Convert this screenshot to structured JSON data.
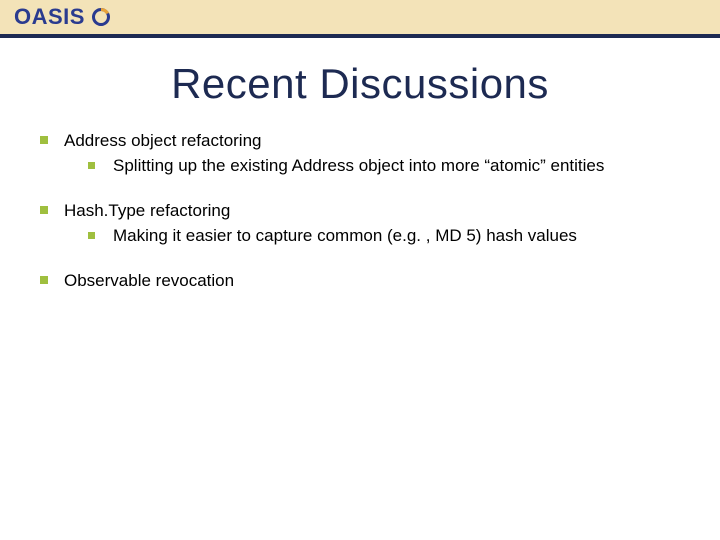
{
  "brand": {
    "logo_text": "OASIS",
    "logo_icon_name": "oasis-swirl-icon"
  },
  "colors": {
    "band": "#f3e3b8",
    "accent": "#1d2a52",
    "title": "#1d2a52",
    "bullet": "#9fbf3f",
    "logo_primary": "#2a3b8f",
    "logo_secondary": "#e8a33a"
  },
  "slide": {
    "title": "Recent Discussions",
    "bullets": [
      {
        "text": "Address object refactoring",
        "children": [
          {
            "text": "Splitting up the existing Address object into more “atomic” entities"
          }
        ]
      },
      {
        "text": "Hash.Type refactoring",
        "children": [
          {
            "text": "Making it easier to capture common (e.g. , MD 5) hash values"
          }
        ]
      },
      {
        "text": "Observable revocation",
        "children": []
      }
    ]
  }
}
